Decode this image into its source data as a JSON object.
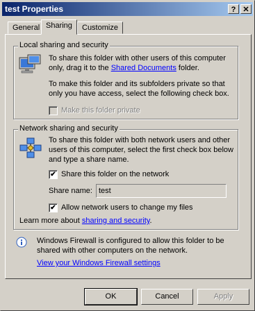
{
  "window": {
    "title": "test Properties",
    "help_glyph": "?",
    "close_glyph": "✕"
  },
  "tabs": [
    {
      "label": "General"
    },
    {
      "label": "Sharing"
    },
    {
      "label": "Customize"
    }
  ],
  "local_sharing": {
    "legend": "Local sharing and security",
    "text1_pre": "To share this folder with other users of this computer only, drag it to the ",
    "text1_link": "Shared Documents",
    "text1_post": " folder.",
    "text2": "To make this folder and its subfolders private so that only you have access, select the following check box.",
    "make_private_label": "Make this folder private",
    "make_private_checked": false,
    "icon": "computers-icon"
  },
  "network_sharing": {
    "legend": "Network sharing and security",
    "text": "To share this folder with both network users and other users of this computer, select the first check box below and type a share name.",
    "share_label": "Share this folder on the network",
    "share_checked": true,
    "share_name_label": "Share name:",
    "share_name_value": "test",
    "allow_change_label": "Allow network users to change my files",
    "allow_change_checked": true,
    "learn_more_pre": "Learn more about ",
    "learn_more_link": "sharing and security",
    "learn_more_post": ".",
    "icon": "network-icon"
  },
  "firewall": {
    "text": "Windows Firewall is configured to allow this folder to be shared with other computers on the network.",
    "link": "View your Windows Firewall settings",
    "icon": "info-icon"
  },
  "buttons": {
    "ok": "OK",
    "cancel": "Cancel",
    "apply": "Apply"
  },
  "check_glyph": "✔",
  "colors": {
    "title_start": "#0a246a",
    "title_end": "#a6caf0",
    "face": "#d4d0c8",
    "link": "#0000ff"
  }
}
